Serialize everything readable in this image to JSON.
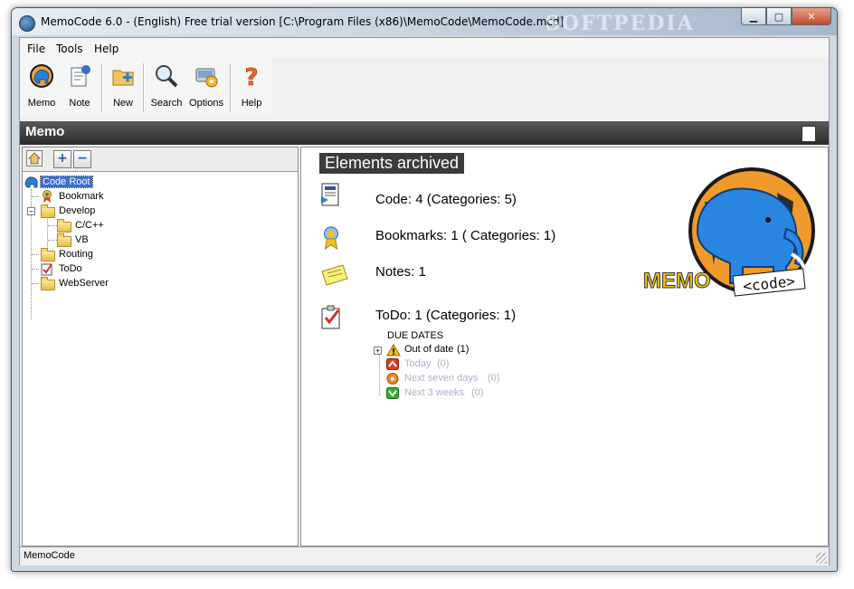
{
  "window": {
    "title": "MemoCode 6.0 - (English) Free trial version  [C:\\Program Files (x86)\\MemoCode\\MemoCode.mcd]",
    "watermark": "SOFTPEDIA",
    "min_glyph": "▁",
    "max_glyph": "▢",
    "close_glyph": "✕"
  },
  "menu": {
    "items": [
      "File",
      "Tools",
      "Help"
    ]
  },
  "toolbar": {
    "buttons": [
      {
        "label": "Memo",
        "icon": "memo-elephant-icon"
      },
      {
        "label": "Note",
        "icon": "note-icon"
      },
      {
        "label": "New",
        "icon": "new-folder-icon"
      },
      {
        "label": "Search",
        "icon": "magnifier-icon"
      },
      {
        "label": "Options",
        "icon": "options-gear-icon"
      },
      {
        "label": "Help",
        "icon": "question-icon"
      }
    ]
  },
  "memo_panel": {
    "title": "Memo"
  },
  "tree": {
    "toolbar": {
      "plus": "+",
      "minus": "−"
    },
    "items": [
      {
        "label": "Code Root",
        "selected": true
      },
      {
        "label": "Bookmark"
      },
      {
        "label": "Develop",
        "expanded": true
      },
      {
        "label": "C/C++"
      },
      {
        "label": "VB"
      },
      {
        "label": "Routing"
      },
      {
        "label": "ToDo"
      },
      {
        "label": "WebServer"
      }
    ],
    "expander_glyph": "−"
  },
  "summary": {
    "heading": "Elements archived",
    "code": "Code: 4 (Categories: 5)",
    "bookmarks": "Bookmarks: 1 ( Categories: 1)",
    "notes": "Notes: 1",
    "todo": "ToDo: 1 (Categories: 1)",
    "due_title": "DUE DATES",
    "due": [
      {
        "label": "Out of date",
        "count": "(1)",
        "color": "#000000",
        "icon_color": "#f2c21b"
      },
      {
        "label": "Today",
        "count": "(0)",
        "color": "#a8b4c6",
        "icon_color": "#d8402a"
      },
      {
        "label": "Next seven days",
        "count": "(0)",
        "color": "#a8b4c6",
        "icon_color": "#f08a1e"
      },
      {
        "label": "Next 3 weeks",
        "count": "(0)",
        "color": "#a8b4c6",
        "icon_color": "#2fb02f"
      }
    ],
    "logo_text": "MEMO",
    "logo_subtext": "<code>"
  },
  "statusbar": {
    "text": "MemoCode"
  }
}
